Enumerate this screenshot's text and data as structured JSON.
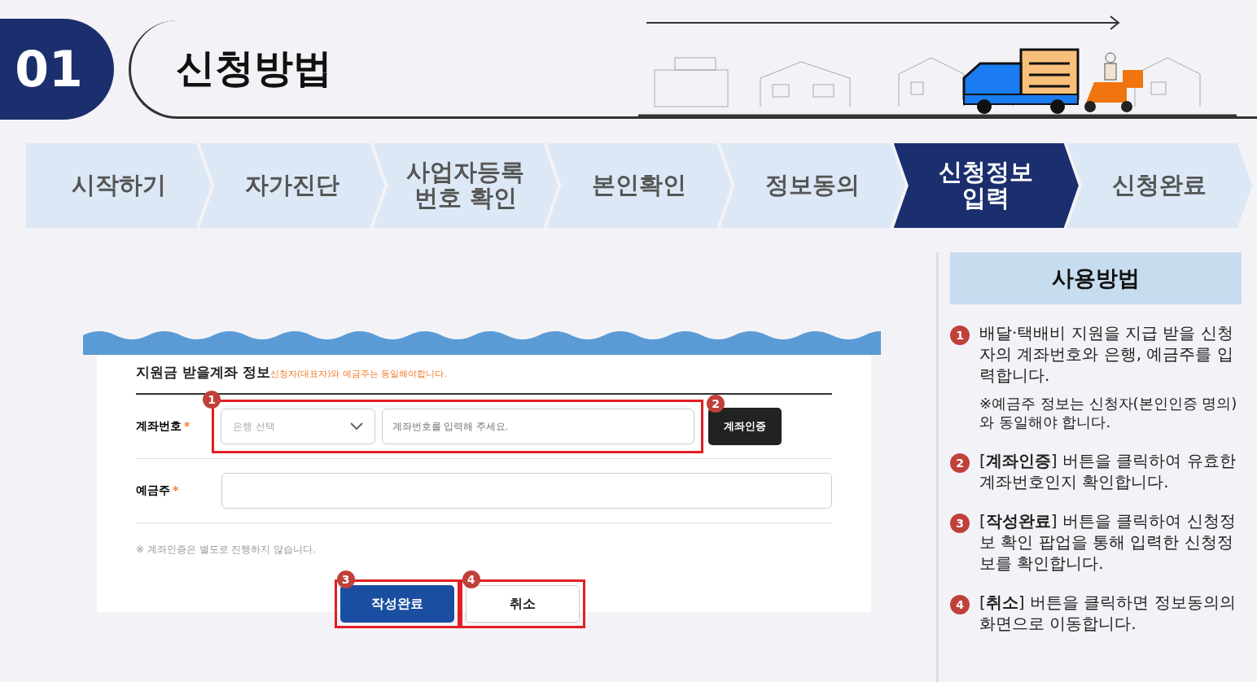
{
  "header": {
    "number": "01",
    "title": "신청방법"
  },
  "steps": [
    {
      "lines": [
        "시작하기"
      ],
      "selected": false
    },
    {
      "lines": [
        "자가진단"
      ],
      "selected": false
    },
    {
      "lines": [
        "사업자등록",
        "번호 확인"
      ],
      "selected": false
    },
    {
      "lines": [
        "본인확인"
      ],
      "selected": false
    },
    {
      "lines": [
        "정보동의"
      ],
      "selected": false
    },
    {
      "lines": [
        "신청정보",
        "입력"
      ],
      "selected": true
    },
    {
      "lines": [
        "신청완료"
      ],
      "selected": false
    }
  ],
  "form": {
    "title": "지원금 받을계좌 정보",
    "notice": "신청자(대표자)와 예금주는 동일해야합니다.",
    "rows": [
      {
        "kind": "account",
        "label": "계좌번호",
        "required": "*",
        "marker": "1",
        "bank_placeholder": "은행 선택",
        "account_placeholder": "계좌번호를 입력해 주세요.",
        "verify_button": "계좌인증",
        "verify_marker": "2"
      },
      {
        "kind": "text",
        "label": "예금주",
        "required": "*"
      }
    ],
    "note": "※ 계좌인증은 별도로 진행하지 않습니다.",
    "buttons": [
      {
        "label": "작성완료",
        "kind": "primary",
        "marker": "3"
      },
      {
        "label": "취소",
        "kind": "secondary",
        "marker": "4"
      }
    ]
  },
  "guide": {
    "title": "사용방법",
    "items": [
      {
        "number": "1",
        "text": "배달·택배비 지원을 지급 받을 신청자의 계좌번호와 은행, 예금주를 입력합니다.",
        "note": "※예금주 정보는 신청자(본인인증 명의)와 동일해야 합니다."
      },
      {
        "number": "2",
        "text": "[**계좌인증**] 버튼을 클릭하여 유효한 계좌번호인지 확인합니다."
      },
      {
        "number": "3",
        "text": "[**작성완료**] 버튼을 클릭하여 신청정보 확인 팝업을 통해 입력한 신청정보를 확인합니다."
      },
      {
        "number": "4",
        "text": "[**취소**] 버튼을 클릭하면 정보동의의 화면으로 이동합니다."
      }
    ]
  }
}
